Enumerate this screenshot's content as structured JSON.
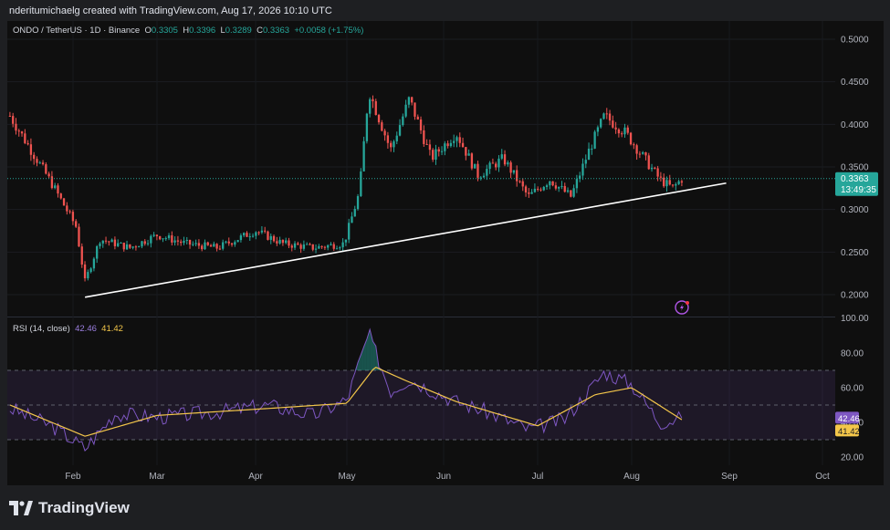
{
  "header": {
    "text": "nderitumichaelg created with TradingView.com, Aug 17, 2026 10:10 UTC"
  },
  "legend": {
    "symbol": "ONDO / TetherUS · 1D · Binance",
    "o_label": "O",
    "o": "0.3305",
    "h_label": "H",
    "h": "0.3396",
    "l_label": "L",
    "l": "0.3289",
    "c_label": "C",
    "c": "0.3363",
    "change": "+0.0058 (+1.75%)"
  },
  "rsi_legend": {
    "label": "RSI (14, close)",
    "rsi": "42.46",
    "ma": "41.42"
  },
  "price_badge": {
    "price": "0.3363",
    "countdown": "13:49:35"
  },
  "rsi_badges": {
    "rsi": "42.46",
    "ma": "41.42"
  },
  "footer": {
    "brand": "TradingView"
  },
  "colors": {
    "up": "#26a69a",
    "down": "#ef5350",
    "rsi": "#7e57c2",
    "rsi_ma": "#f3c64a",
    "trend": "#ffffff"
  },
  "chart_data": [
    {
      "type": "candlestick",
      "title": "ONDO / TetherUS · 1D · Binance",
      "x_axis": {
        "ticks": [
          "Feb",
          "Mar",
          "Apr",
          "May",
          "Jun",
          "Jul",
          "Aug",
          "Sep",
          "Oct"
        ]
      },
      "y_axis": {
        "ticks": [
          "0.5000",
          "0.4500",
          "0.4000",
          "0.3500",
          "0.3000",
          "0.2500",
          "0.2000"
        ],
        "ylim": [
          0.185,
          0.505
        ]
      },
      "series": [
        {
          "name": "ONDO / TetherUS",
          "approx_close_path": [
            [
              "Jan 11",
              0.41
            ],
            [
              "Jan 18",
              0.37
            ],
            [
              "Jan 25",
              0.33
            ],
            [
              "Feb 2",
              0.28
            ],
            [
              "Feb 5",
              0.215
            ],
            [
              "Feb 10",
              0.265
            ],
            [
              "Feb 20",
              0.255
            ],
            [
              "Mar 1",
              0.27
            ],
            [
              "Mar 10",
              0.26
            ],
            [
              "Mar 20",
              0.255
            ],
            [
              "Apr 1",
              0.275
            ],
            [
              "Apr 10",
              0.26
            ],
            [
              "Apr 20",
              0.255
            ],
            [
              "Apr 30",
              0.26
            ],
            [
              "May 5",
              0.32
            ],
            [
              "May 8",
              0.44
            ],
            [
              "May 15",
              0.37
            ],
            [
              "May 21",
              0.43
            ],
            [
              "May 28",
              0.36
            ],
            [
              "Jun 5",
              0.39
            ],
            [
              "Jun 12",
              0.34
            ],
            [
              "Jun 20",
              0.36
            ],
            [
              "Jun 28",
              0.315
            ],
            [
              "Jul 5",
              0.335
            ],
            [
              "Jul 12",
              0.315
            ],
            [
              "Jul 18",
              0.37
            ],
            [
              "Jul 23",
              0.41
            ],
            [
              "Jul 30",
              0.39
            ],
            [
              "Aug 5",
              0.36
            ],
            [
              "Aug 10",
              0.335
            ],
            [
              "Aug 14",
              0.325
            ],
            [
              "Aug 17",
              0.3363
            ]
          ],
          "last": {
            "open": 0.3305,
            "high": 0.3396,
            "low": 0.3289,
            "close": 0.3363
          }
        }
      ],
      "annotations": [
        {
          "type": "trendline",
          "from": [
            "Feb 5",
            0.197
          ],
          "to": [
            "Aug 31",
            0.331
          ]
        }
      ]
    },
    {
      "type": "line",
      "title": "RSI (14, close)",
      "y_axis": {
        "ticks": [
          "100.00",
          "80.00",
          "60.00",
          "40.00",
          "20.00"
        ],
        "ylim": [
          12,
          100
        ]
      },
      "bands": {
        "upper": 70,
        "middle": 50,
        "lower": 30
      },
      "series": [
        {
          "name": "RSI",
          "approx_path": [
            [
              "Jan 11",
              48
            ],
            [
              "Jan 25",
              38
            ],
            [
              "Feb 5",
              25
            ],
            [
              "Feb 15",
              45
            ],
            [
              "Mar 1",
              43
            ],
            [
              "Mar 20",
              46
            ],
            [
              "Apr 5",
              50
            ],
            [
              "Apr 20",
              44
            ],
            [
              "May 1",
              53
            ],
            [
              "May 8",
              91
            ],
            [
              "May 15",
              58
            ],
            [
              "May 21",
              65
            ],
            [
              "Jun 5",
              52
            ],
            [
              "Jun 15",
              46
            ],
            [
              "Jun 28",
              36
            ],
            [
              "Jul 10",
              42
            ],
            [
              "Jul 23",
              69
            ],
            [
              "Aug 1",
              62
            ],
            [
              "Aug 10",
              40
            ],
            [
              "Aug 17",
              42.46
            ]
          ],
          "last": 42.46
        },
        {
          "name": "RSI-based MA",
          "approx_path": [
            [
              "Jan 11",
              50
            ],
            [
              "Feb 5",
              32
            ],
            [
              "Mar 1",
              44
            ],
            [
              "Apr 5",
              48
            ],
            [
              "May 1",
              51
            ],
            [
              "May 10",
              72
            ],
            [
              "May 20",
              64
            ],
            [
              "Jun 5",
              52
            ],
            [
              "Jul 1",
              38
            ],
            [
              "Jul 20",
              56
            ],
            [
              "Aug 1",
              60
            ],
            [
              "Aug 17",
              41.42
            ]
          ],
          "last": 41.42
        }
      ]
    }
  ]
}
